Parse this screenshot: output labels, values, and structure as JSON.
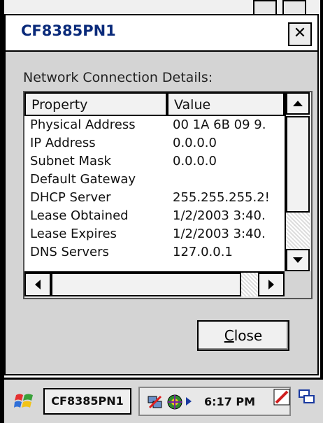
{
  "window": {
    "title": "CF8385PN1",
    "close_glyph": "✕"
  },
  "section_label": "Network Connection Details:",
  "table": {
    "columns": [
      "Property",
      "Value"
    ],
    "rows": [
      [
        "Physical Address",
        "00 1A 6B 09 9."
      ],
      [
        "IP Address",
        "0.0.0.0"
      ],
      [
        "Subnet Mask",
        "0.0.0.0"
      ],
      [
        "Default Gateway",
        ""
      ],
      [
        "DHCP Server",
        "255.255.255.2!"
      ],
      [
        "Lease Obtained",
        "1/2/2003 3:40."
      ],
      [
        "Lease Expires",
        "1/2/2003 3:40."
      ],
      [
        "DNS Servers",
        "127.0.0.1"
      ]
    ]
  },
  "buttons": {
    "close_prefix": "C",
    "close_rest": "lose"
  },
  "taskbar": {
    "task_label": "CF8385PN1",
    "time": "6:17 PM",
    "icons": [
      "start-icon",
      "network-icon",
      "connection-icon",
      "stylus-icon",
      "windows-switch-icon"
    ]
  },
  "colors": {
    "title_text": "#0a2a7a",
    "dialog_bg": "#d4d4d4"
  }
}
